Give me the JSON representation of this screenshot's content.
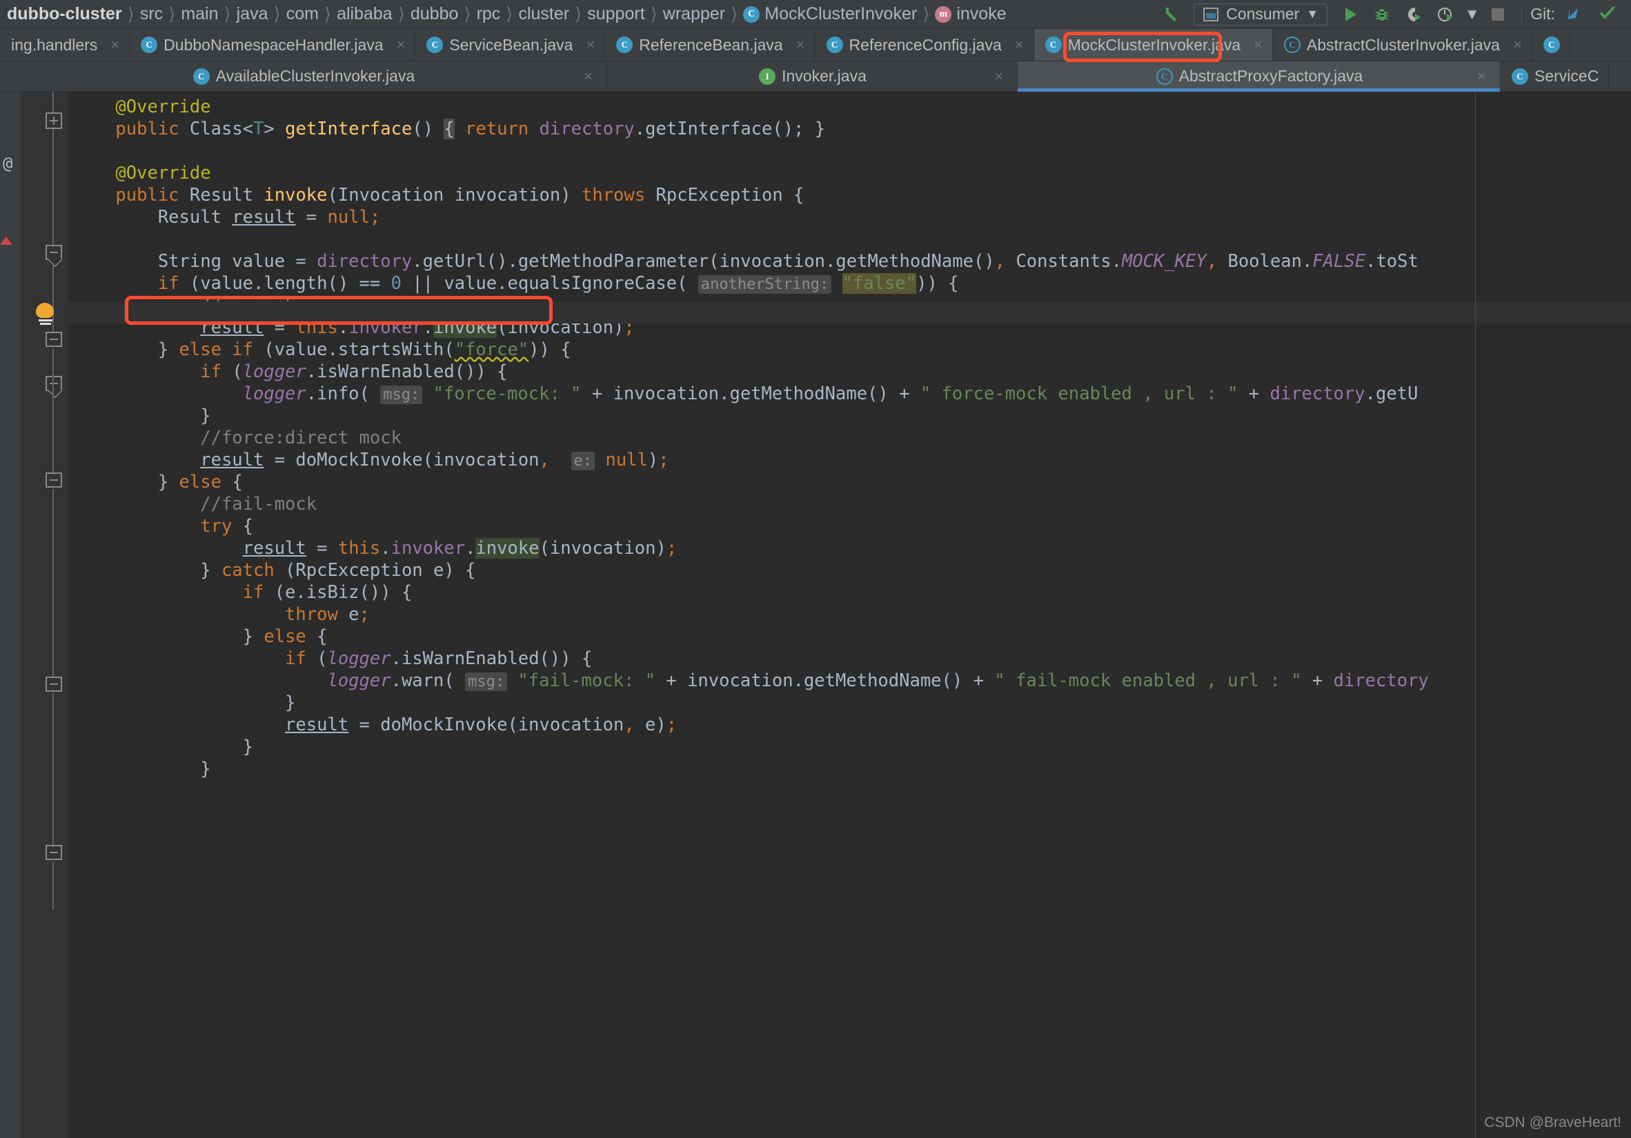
{
  "breadcrumb": {
    "items": [
      {
        "label": "dubbo-cluster",
        "icon": "",
        "bold": true
      },
      {
        "label": "src",
        "icon": ""
      },
      {
        "label": "main",
        "icon": ""
      },
      {
        "label": "java",
        "icon": ""
      },
      {
        "label": "com",
        "icon": ""
      },
      {
        "label": "alibaba",
        "icon": ""
      },
      {
        "label": "dubbo",
        "icon": ""
      },
      {
        "label": "rpc",
        "icon": ""
      },
      {
        "label": "cluster",
        "icon": ""
      },
      {
        "label": "support",
        "icon": ""
      },
      {
        "label": "wrapper",
        "icon": ""
      },
      {
        "label": "MockClusterInvoker",
        "icon": "class-icon",
        "badge": "C"
      },
      {
        "label": "invoke",
        "icon": "method-icon",
        "badge": "m"
      }
    ],
    "separator": "〉"
  },
  "toolbar": {
    "back_arrow_icon": "back-arrow-icon",
    "run_config": {
      "label": "Consumer",
      "dropdown": "▼",
      "icon": "run-config-icon"
    },
    "run_icon": "run-icon",
    "debug_icon": "debug-icon",
    "run_coverage_icon": "run-with-coverage-icon",
    "profiler_icon": "profiler-icon",
    "profiler_dropdown": "▼",
    "stop_icon": "stop-icon",
    "git_label": "Git:",
    "git_update_icon": "git-update-icon",
    "git_commit_icon": "git-commit-check-icon"
  },
  "tabs_row1": [
    {
      "label": "ing.handlers",
      "icon": "none",
      "active": false,
      "close": "×"
    },
    {
      "label": "DubboNamespaceHandler.java",
      "icon": "class-icon",
      "badge": "C",
      "active": false,
      "close": "×"
    },
    {
      "label": "ServiceBean.java",
      "icon": "class-icon",
      "badge": "C",
      "active": false,
      "close": "×"
    },
    {
      "label": "ReferenceBean.java",
      "icon": "class-icon",
      "badge": "C",
      "active": false,
      "close": "×"
    },
    {
      "label": "ReferenceConfig.java",
      "icon": "class-icon",
      "badge": "C",
      "active": false,
      "close": "×"
    },
    {
      "label": "MockClusterInvoker.java",
      "icon": "class-icon",
      "badge": "C",
      "active": true,
      "close": "×"
    },
    {
      "label": "AbstractClusterInvoker.java",
      "icon": "abstract-class-icon",
      "badge": "C",
      "active": false,
      "close": "×"
    },
    {
      "label": "",
      "icon": "class-icon",
      "badge": "C",
      "active": false,
      "close": ""
    }
  ],
  "tabs_row2": [
    {
      "label": "AvailableClusterInvoker.java",
      "icon": "class-icon",
      "badge": "C",
      "active": false,
      "close": "×"
    },
    {
      "label": "Invoker.java",
      "icon": "interface-icon",
      "badge": "I",
      "active": false,
      "close": "×"
    },
    {
      "label": "AbstractProxyFactory.java",
      "icon": "abstract-class-icon",
      "badge": "C",
      "active": true,
      "close": "×"
    },
    {
      "label": "ServiceC",
      "icon": "class-icon",
      "badge": "C",
      "active": false,
      "close": ""
    }
  ],
  "highlights": {
    "tab_highlight_color": "#ff4b30",
    "code_highlight_color": "#ff4b30",
    "highlighted_tab": "MockClusterInvoker.java",
    "highlighted_code_line": "result = this.invoker.invoke(invocation);"
  },
  "editor": {
    "file": "MockClusterInvoker.java",
    "gutter_icons": [
      "lightbulb-intention-icon"
    ],
    "code_lines": [
      "    @Override",
      "    public Class<T> getInterface() { return directory.getInterface(); }",
      "",
      "    @Override",
      "    public Result invoke(Invocation invocation) throws RpcException {",
      "        Result result = null;",
      "",
      "        String value = directory.getUrl().getMethodParameter(invocation.getMethodName(), Constants.MOCK_KEY, Boolean.FALSE.toSt",
      "        if (value.length() == 0 || value.equalsIgnoreCase( anotherString: \"false\")) {",
      "            //no mock",
      "            result = this.invoker.invoke(invocation);",
      "        } else if (value.startsWith(\"force\")) {",
      "            if (logger.isWarnEnabled()) {",
      "                logger.info( msg: \"force-mock: \" + invocation.getMethodName() + \" force-mock enabled , url : \" + directory.getU",
      "            }",
      "            //force:direct mock",
      "            result = doMockInvoke(invocation,  e: null);",
      "        } else {",
      "            //fail-mock",
      "            try {",
      "                result = this.invoker.invoke(invocation);",
      "            } catch (RpcException e) {",
      "                if (e.isBiz()) {",
      "                    throw e;",
      "                } else {",
      "                    if (logger.isWarnEnabled()) {",
      "                        logger.warn( msg: \"fail-mock: \" + invocation.getMethodName() + \" fail-mock enabled , url : \" + directory",
      "                    }",
      "                    result = doMockInvoke(invocation, e);",
      "                }",
      "            }"
    ],
    "inlay_hints": [
      "anotherString:",
      "msg:",
      "e:",
      "msg:"
    ],
    "colors": {
      "background": "#2b2b2b",
      "keyword": "#cc7832",
      "annotation": "#bbb529",
      "comment": "#808080",
      "string": "#6a8759",
      "number": "#6897bb",
      "field": "#9876aa",
      "method": "#ffc66d",
      "text": "#a9b7c6"
    }
  },
  "watermark": "CSDN @BraveHeart!"
}
